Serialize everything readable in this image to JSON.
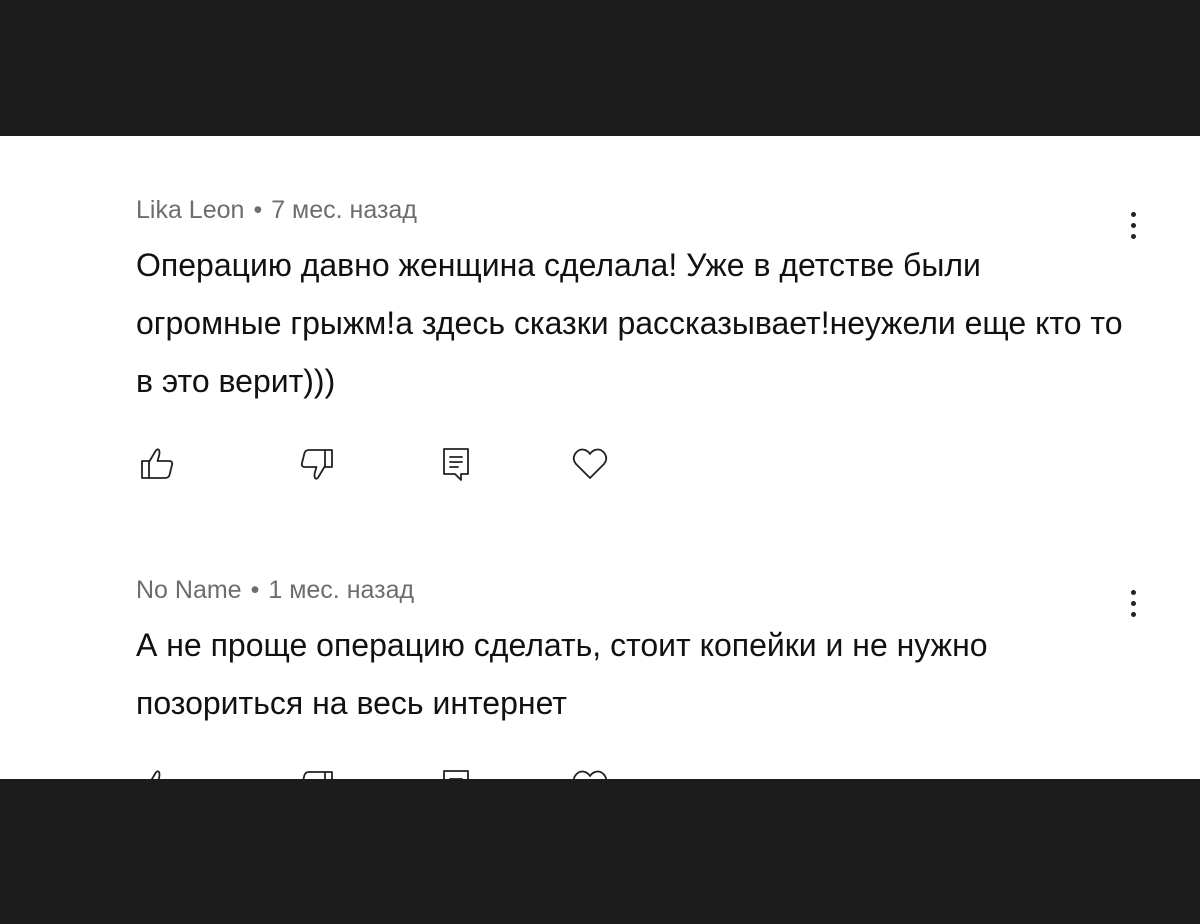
{
  "comments": [
    {
      "author": "Lika Leon",
      "separator": "•",
      "time": "7 мес. назад",
      "text": "Операцию давно женщина сделала! Уже в детстве были огромные грыжм!а здесь сказки рассказывает!неужели еще кто то в это верит)))"
    },
    {
      "author": "No Name",
      "separator": "•",
      "time": "1 мес. назад",
      "text": "А не проще операцию сделать, стоит копейки и не нужно позориться на весь интернет"
    }
  ],
  "icons": {
    "like": "thumbs-up-icon",
    "dislike": "thumbs-down-icon",
    "reply": "reply-icon",
    "favorite": "heart-icon",
    "more": "more-vertical-icon"
  },
  "colors": {
    "background_dark": "#1c1c1c",
    "panel": "#ffffff",
    "meta_text": "#6d6d6d",
    "body_text": "#111111"
  }
}
